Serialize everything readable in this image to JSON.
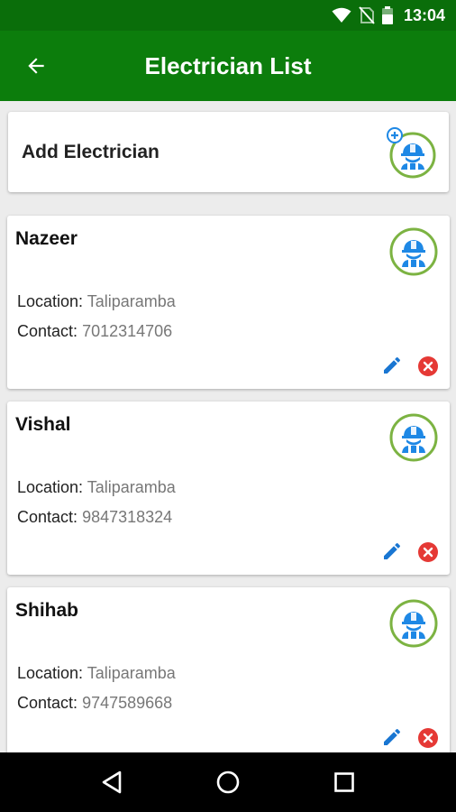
{
  "status": {
    "time": "13:04",
    "icons": [
      "wifi-icon",
      "no-sim-icon",
      "battery-icon"
    ]
  },
  "app_bar": {
    "title": "Electrician List",
    "back_icon": "arrow-back-icon",
    "color": "#0c7d0c"
  },
  "add_card": {
    "label": "Add Electrician",
    "icon": "add-worker-icon"
  },
  "labels": {
    "location": "Location:",
    "contact": "Contact:"
  },
  "electricians": [
    {
      "name": "Nazeer",
      "location": "Taliparamba",
      "contact": "7012314706"
    },
    {
      "name": "Vishal",
      "location": "Taliparamba",
      "contact": "9847318324"
    },
    {
      "name": "Shihab",
      "location": "Taliparamba",
      "contact": "9747589668"
    }
  ],
  "colors": {
    "edit": "#1976d2",
    "delete": "#e53935",
    "avatar_ring": "#7cb342",
    "worker": "#1e88e5"
  },
  "nav": {
    "back": "nav-back-icon",
    "home": "nav-home-icon",
    "recents": "nav-recents-icon"
  }
}
